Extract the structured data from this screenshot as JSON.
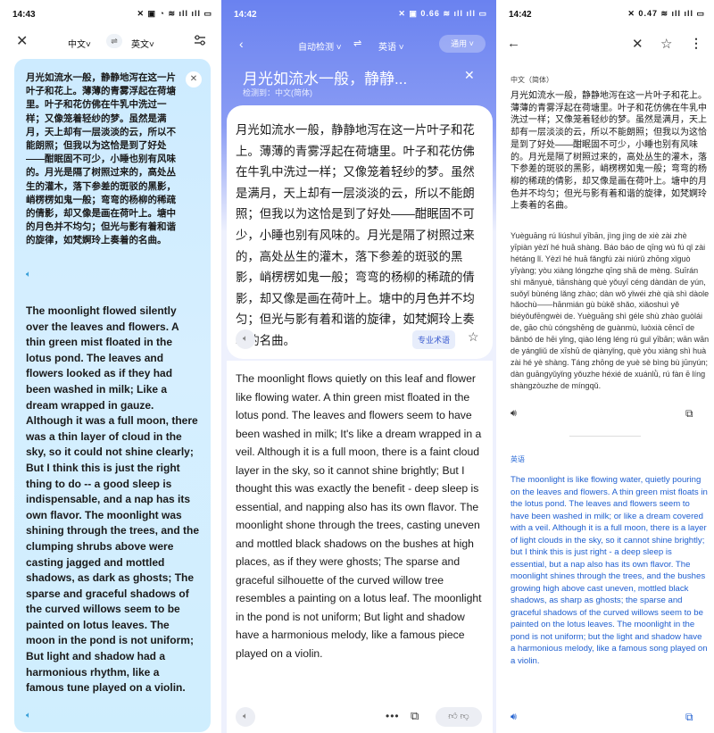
{
  "panel1": {
    "status": {
      "time": "14:43",
      "icons": "✕ ▣ ◔ ≋ ıll ıll ▭"
    },
    "toolbar": {
      "source_lang": "中文˅",
      "swap": "⇌",
      "target_lang": "英文˅"
    },
    "source_text": "月光如流水一般，静静地泻在这一片叶子和花上。薄薄的青雾浮起在荷塘里。叶子和花仿佛在牛乳中洗过一样；又像笼着轻纱的梦。虽然是满月，天上却有一层淡淡的云，所以不能朗照；但我以为这恰是到了好处——酣眠固不可少，小睡也别有风味的。月光是隔了树照过来的，高处丛生的灌木，落下参差的斑驳的黑影，峭楞楞如鬼一般；弯弯的杨柳的稀疏的倩影，却又像是画在荷叶上。塘中的月色并不均匀；但光与影有着和谐的旋律，如梵婀玲上奏着的名曲。",
    "translation": "The moonlight flowed silently over the leaves and flowers. A thin green mist floated in the lotus pond. The leaves and flowers looked as if they had been washed in milk; Like a dream wrapped in gauze. Although it was a full moon, there was a thin layer of cloud in the sky, so it could not shine clearly; But I think this is just the right thing to do -- a good sleep is indispensable, and a nap has its own flavor. The moonlight was shining through the trees, and the clumping shrubs above were casting jagged and mottled shadows, as dark as ghosts; The sparse and graceful shadows of the curved willows seem to be painted on lotus leaves. The moon in the pond is not uniform; But light and shadow had a harmonious rhythm, like a famous tune played on a violin."
  },
  "panel2": {
    "status": {
      "time": "14:42",
      "icons": "✕ ▣ 0.66 ≋ ıll ıll ▭"
    },
    "toolbar": {
      "source_lang": "自动检测 ˅",
      "swap": "⇌",
      "target_lang": "英语 ˅",
      "mode": "通用 ˅"
    },
    "header_title": "月光如流水一般，静静...",
    "detected": "检测到：中文(简体)",
    "source_text": "月光如流水一般，静静地泻在这一片叶子和花上。薄薄的青雾浮起在荷塘里。叶子和花仿佛在牛乳中洗过一样；又像笼着轻纱的梦。虽然是满月，天上却有一层淡淡的云，所以不能朗照；但我以为这恰是到了好处——酣眠固不可少，小睡也别有风味的。月光是隔了树照过来的，高处丛生的灌木，落下参差的斑驳的黑影，峭楞楞如鬼一般；弯弯的杨柳的稀疏的倩影，却又像是画在荷叶上。塘中的月色并不均匀；但光与影有着和谐的旋律，如梵婀玲上奏着的名曲。",
    "term_button": "专业术语",
    "translation": "The moonlight flows quietly on this leaf and flower like flowing water. A thin green mist floated in the lotus pond. The leaves and flowers seem to have been washed in milk; It's like a dream wrapped in a veil. Although it is a full moon, there is a faint cloud layer in the sky, so it cannot shine brightly; But I thought this was exactly the benefit - deep sleep is essential, and napping also has its own flavor. The moonlight shone through the trees, casting uneven and mottled black shadows on the bushes at high places, as if they were ghosts; The sparse and graceful silhouette of the curved willow tree resembles a painting on a lotus leaf. The moonlight in the pond is not uniform; But light and shadow have a harmonious melody, like a famous piece played on a violin."
  },
  "panel3": {
    "status": {
      "time": "14:42",
      "icons": "✕ 0.47 ≋ ıll ıll ▭"
    },
    "source_label": "中文（简体）",
    "source_text": "月光如流水一般，静静地泻在这一片叶子和花上。薄薄的青雾浮起在荷塘里。叶子和花仿佛在牛乳中洗过一样；又像笼着轻纱的梦。虽然是满月，天上却有一层淡淡的云，所以不能朗照；但我以为这恰是到了好处——酣眠固不可少，小睡也别有风味的。月光是隔了树照过来的，高处丛生的灌木，落下参差的斑驳的黑影，峭楞楞如鬼一般；弯弯的杨柳的稀疏的倩影，却又像是画在荷叶上。塘中的月色并不均匀；但光与影有着和谐的旋律，如梵婀玲上奏着的名曲。",
    "pinyin": "Yuèguāng rú liúshuǐ yībān, jìng jìng de xiè zài zhè yīpiàn yèzǐ hé huā shàng. Báo báo de qīng wù fú qǐ zài hétáng lǐ. Yèzǐ hé huā fǎngfú zài niúrǔ zhōng xǐguò yīyàng; yòu xiàng lóngzhe qīng shā de mèng. Suīrán shì mǎnyuè, tiānshàng què yǒuyī céng dàndàn de yún, suǒyǐ bùnéng lǎng zhào; dàn wǒ yǐwéi zhè qià shì dàole hǎochù——hānmián gù bùkě shǎo, xiǎoshuì yě biéyǒufēngwèi de. Yuèguāng shì géle shù zhào guòlái de, gāo chù cóngshēng de guànmù, luòxià cēncī de bānbó de hēi yǐng, qiào léng léng rú guǐ yībān; wān wān de yángliǔ de xīshū de qiànyǐng, què yòu xiàng shì huà zài hé yè shàng. Táng zhōng de yuè sè bìng bù jūnyún; dàn guāngyǔyǐng yǒuzhe héxié de xuánlǜ, rú fàn ē líng shàngzòuzhe de míngqǔ.",
    "target_label": "英语",
    "translation": "The moonlight is like flowing water, quietly pouring on the leaves and flowers. A thin green mist floats in the lotus pond. The leaves and flowers seem to have been washed in milk; or like a dream covered with a veil. Although it is a full moon, there is a layer of light clouds in the sky, so it cannot shine brightly; but I think this is just right - a deep sleep is essential, but a nap also has its own flavor. The moonlight shines through the trees, and the bushes growing high above cast uneven, mottled black shadows, as sharp as ghosts; the sparse and graceful shadows of the curved willows seem to be painted on the lotus leaves. The moonlight in the pond is not uniform; but the light and shadow have a harmonious melody, like a famous song played on a violin."
  }
}
